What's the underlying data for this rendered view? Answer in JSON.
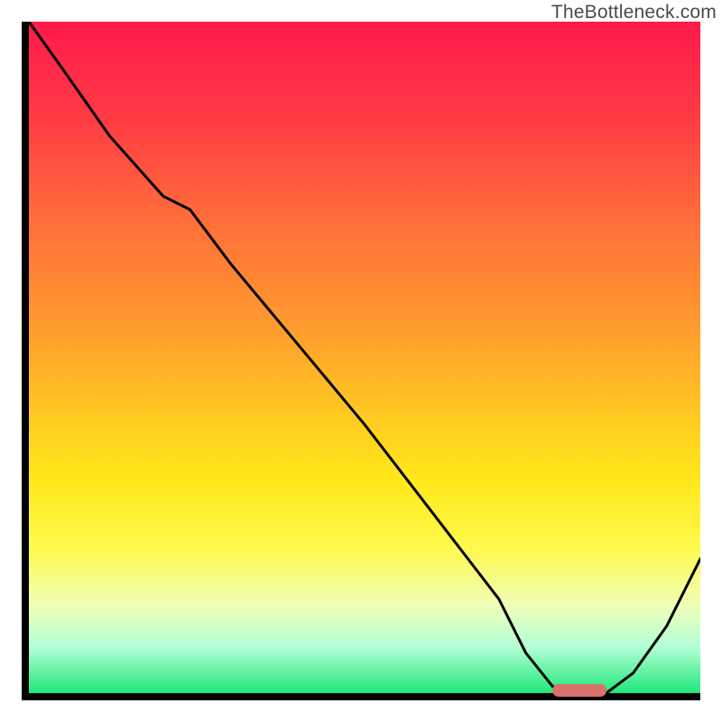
{
  "watermark": "TheBottleneck.com",
  "chart_data": {
    "type": "line",
    "title": "",
    "xlabel": "",
    "ylabel": "",
    "xlim": [
      0,
      100
    ],
    "ylim": [
      0,
      100
    ],
    "grid": false,
    "legend": false,
    "notes": "Axes carry no visible tick labels; curve depicts a bottleneck metric that falls from ~100 to 0 near x≈80 and rises again toward x=100. Background is a vertical red→green gradient. A short rounded salmon bar near x≈80 marks the optimum (minimum) region.",
    "series": [
      {
        "name": "bottleneck",
        "x": [
          0,
          5,
          12,
          20,
          24,
          30,
          40,
          50,
          60,
          70,
          74,
          78,
          82,
          86,
          90,
          95,
          100
        ],
        "values": [
          100,
          93,
          83,
          74,
          72,
          64,
          52,
          40,
          27,
          14,
          6,
          1,
          0,
          0,
          3,
          10,
          20
        ]
      }
    ],
    "optimum_region": {
      "x_start": 78,
      "x_end": 86,
      "y": 0
    },
    "colors": {
      "curve": "#000000",
      "optimum_bar": "#d9726a",
      "gradient_top": "#ff1a4a",
      "gradient_bottom": "#20e87a",
      "axis": "#000000"
    }
  }
}
